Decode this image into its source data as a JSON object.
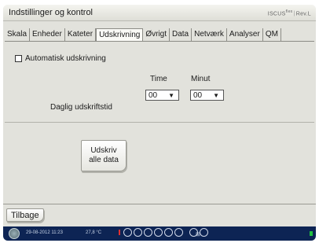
{
  "window": {
    "title": "Indstillinger og kontrol",
    "brand": "ISCUS",
    "brand_sup": "flex",
    "brand_suffix": "Rev.L"
  },
  "tabs": [
    {
      "label": "Skala"
    },
    {
      "label": "Enheder"
    },
    {
      "label": "Kateter"
    },
    {
      "label": "Udskrivning",
      "active": true
    },
    {
      "label": "Øvrigt"
    },
    {
      "label": "Data"
    },
    {
      "label": "Netværk"
    },
    {
      "label": "Analyser"
    },
    {
      "label": "QM"
    }
  ],
  "panel": {
    "auto_print_label": "Automatisk udskrivning",
    "auto_print_checked": false,
    "daily_time_label": "Daglig udskriftstid",
    "hour_label": "Time",
    "minute_label": "Minut",
    "hour_value": "00",
    "minute_value": "00",
    "print_all_line1": "Udskriv",
    "print_all_line2": "alle data"
  },
  "footer": {
    "back_label": "Tilbage"
  },
  "status": {
    "datetime": "29-08-2012 11:23",
    "temperature": "27,8 °C",
    "icons": [
      "power-icon",
      "slot-indicators",
      "network-icon"
    ]
  }
}
